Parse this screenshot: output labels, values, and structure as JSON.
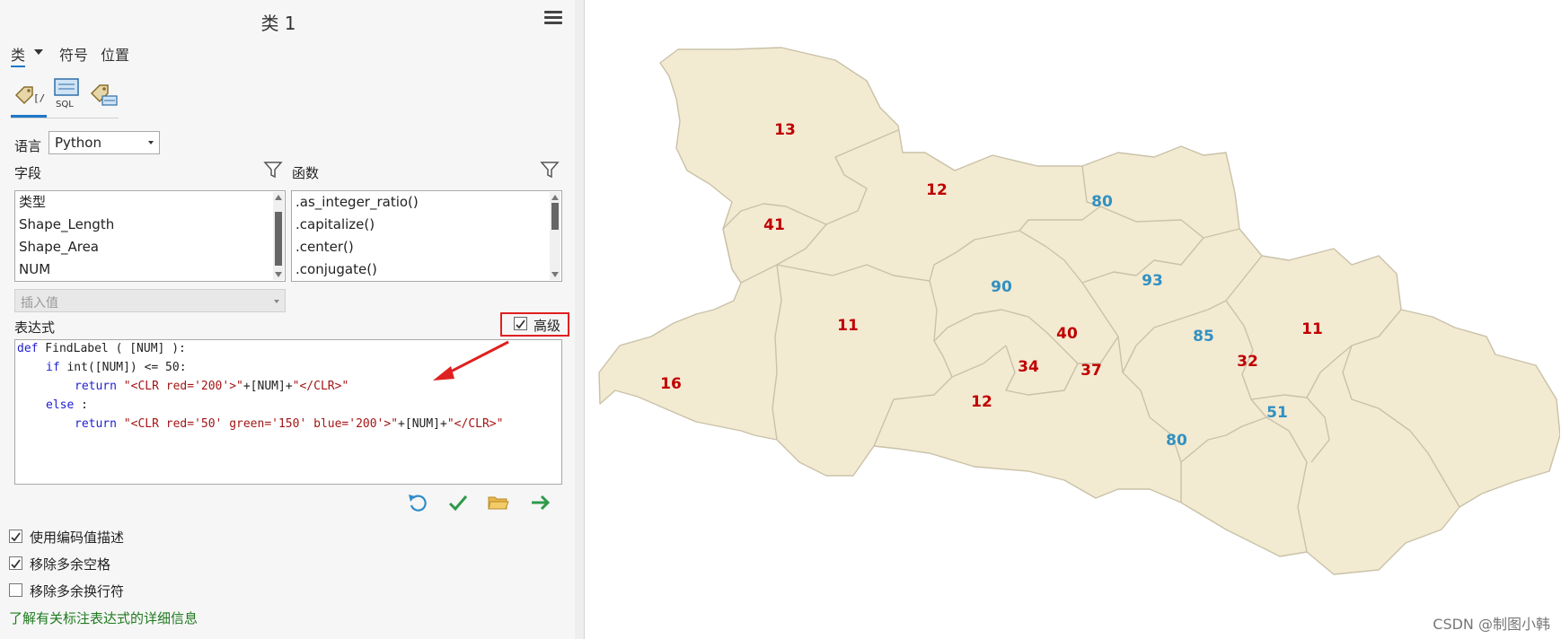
{
  "panel": {
    "title": "类 1",
    "tabs": {
      "class": "类",
      "symbol": "符号",
      "position": "位置"
    },
    "modes": [
      {
        "name": "expression-mode-icon",
        "active": true
      },
      {
        "name": "sql-mode-icon",
        "label": "SQL",
        "active": false
      },
      {
        "name": "label-class-mode-icon",
        "active": false
      }
    ],
    "language": {
      "label": "语言",
      "value": "Python"
    },
    "fields": {
      "label": "字段",
      "items": [
        "类型",
        "Shape_Length",
        "Shape_Area",
        "NUM"
      ]
    },
    "functions": {
      "label": "函数",
      "items": [
        ".as_integer_ratio()",
        ".capitalize()",
        ".center()",
        ".conjugate()"
      ]
    },
    "insert_value": {
      "placeholder": "插入值"
    },
    "expression": {
      "label": "表达式",
      "advanced_label": "高级",
      "advanced_checked": true,
      "code": {
        "l1_kw": "def",
        "l1_rest": " FindLabel ( [NUM] ):",
        "l2_kw": "if",
        "l2_rest": " int([NUM]) <= 50:",
        "l3_kw": "return",
        "l3_str1": "\"<CLR red='200'>\"",
        "l3_mid": "+[NUM]+",
        "l3_str2": "\"</CLR>\"",
        "l4_kw": "else",
        "l4_rest": " :",
        "l5_kw": "return",
        "l5_str1": "\"<CLR red='50' green='150' blue='200'>\"",
        "l5_mid": "+[NUM]+",
        "l5_str2": "\"</CLR>\""
      }
    },
    "toolbar_icons": [
      "undo-icon",
      "verify-icon",
      "open-folder-icon",
      "apply-arrow-icon"
    ],
    "options": [
      {
        "label": "使用编码值描述",
        "checked": true
      },
      {
        "label": "移除多余空格",
        "checked": true
      },
      {
        "label": "移除多余换行符",
        "checked": false
      }
    ],
    "learn_more": "了解有关标注表达式的详细信息"
  },
  "map": {
    "fill_color": "#f3ead2",
    "border_color": "#c9c1a8",
    "red_color": "#c00000",
    "blue_color": "#3291c1",
    "labels": [
      "13",
      "12",
      "80",
      "41",
      "90",
      "93",
      "11",
      "40",
      "85",
      "11",
      "16",
      "34",
      "37",
      "32",
      "12",
      "51",
      "80"
    ]
  },
  "watermark": "CSDN @制图小韩"
}
